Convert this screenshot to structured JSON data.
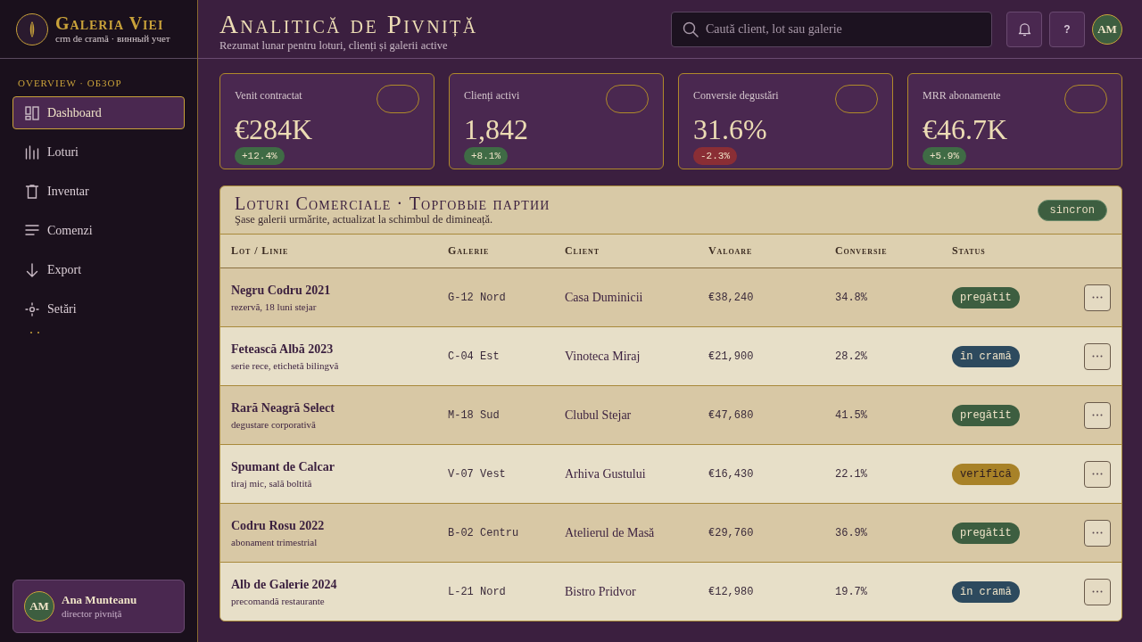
{
  "sidebar": {
    "brand": {
      "name": "Galeria Viei",
      "tagline": "crm de cramă · винный учет"
    },
    "section_label": "OVERVIEW · ОБЗОР",
    "items": [
      {
        "label": "Dashboard",
        "kind": "dashboard",
        "selected": true
      },
      {
        "label": "Loturi",
        "kind": "lots",
        "selected": false
      },
      {
        "label": "Inventar",
        "kind": "inventory",
        "selected": false
      },
      {
        "label": "Comenzi",
        "kind": "orders",
        "selected": false
      },
      {
        "label": "Export",
        "kind": "export",
        "selected": false
      },
      {
        "label": "Setări",
        "kind": "settings",
        "selected": false
      }
    ],
    "user": {
      "initials": "AM",
      "name": "Ana Munteanu",
      "role": "director pivniță"
    }
  },
  "header": {
    "title": "Analitică de Pivniță",
    "subtitle": "Rezumat lunar pentru loturi, clienți și galerii active",
    "search": {
      "placeholder": "Caută client, lot sau galerie"
    },
    "help_label": "?",
    "avatar_initials": "AM"
  },
  "stats": [
    {
      "label": "Venit contractat",
      "value": "€284K",
      "delta": {
        "label": "+12.4%",
        "color": "#3f6b45"
      }
    },
    {
      "label": "Clienți activi",
      "value": "1,842",
      "delta": {
        "label": "+8.1%",
        "color": "#3f6b45"
      }
    },
    {
      "label": "Conversie degustări",
      "value": "31.6%",
      "delta": {
        "label": "-2.3%",
        "color": "#8a2e35"
      }
    },
    {
      "label": "MRR abonamente",
      "value": "€46.7K",
      "delta": {
        "label": "+5.9%",
        "color": "#3f6b45"
      }
    }
  ],
  "table": {
    "title": "Loturi Comerciale · Торговые партии",
    "subtitle": "Şase galerii urmărite, actualizat la schimbul de dimineață.",
    "sync_badge": "sincron",
    "columns": [
      "Lot / Linie",
      "Galerie",
      "Client",
      "Valoare",
      "Conversie",
      "Status"
    ],
    "rows": [
      {
        "lot": "Negru Codru 2021",
        "note": "rezervă, 18 luni stejar",
        "gallery": "G-12 Nord",
        "client": "Casa Duminicii",
        "value": "€38,240",
        "conversion": "34.8%",
        "status": {
          "label": "pregătit",
          "color": "#3d5e40"
        }
      },
      {
        "lot": "Fetească Albă 2023",
        "note": "serie rece, etichetă bilingvă",
        "gallery": "C-04 Est",
        "client": "Vinoteca Miraj",
        "value": "€21,900",
        "conversion": "28.2%",
        "status": {
          "label": "în cramă",
          "color": "#2d4a5e"
        }
      },
      {
        "lot": "Rară Neagră Select",
        "note": "degustare corporativă",
        "gallery": "M-18 Sud",
        "client": "Clubul Stejar",
        "value": "€47,680",
        "conversion": "41.5%",
        "status": {
          "label": "pregătit",
          "color": "#3d5e40"
        }
      },
      {
        "lot": "Spumant de Calcar",
        "note": "tiraj mic, sală boltită",
        "gallery": "V-07 Vest",
        "client": "Arhiva Gustului",
        "value": "€16,430",
        "conversion": "22.1%",
        "status": {
          "label": "verifică",
          "color": "#a88228"
        }
      },
      {
        "lot": "Codru Rosu 2022",
        "note": "abonament trimestrial",
        "gallery": "B-02 Centru",
        "client": "Atelierul de Masă",
        "value": "€29,760",
        "conversion": "36.9%",
        "status": {
          "label": "pregătit",
          "color": "#3d5e40"
        }
      },
      {
        "lot": "Alb de Galerie 2024",
        "note": "precomandă restaurante",
        "gallery": "L-21 Nord",
        "client": "Bistro Pridvor",
        "value": "€12,980",
        "conversion": "19.7%",
        "status": {
          "label": "în cramă",
          "color": "#2d4a5e"
        }
      }
    ]
  }
}
